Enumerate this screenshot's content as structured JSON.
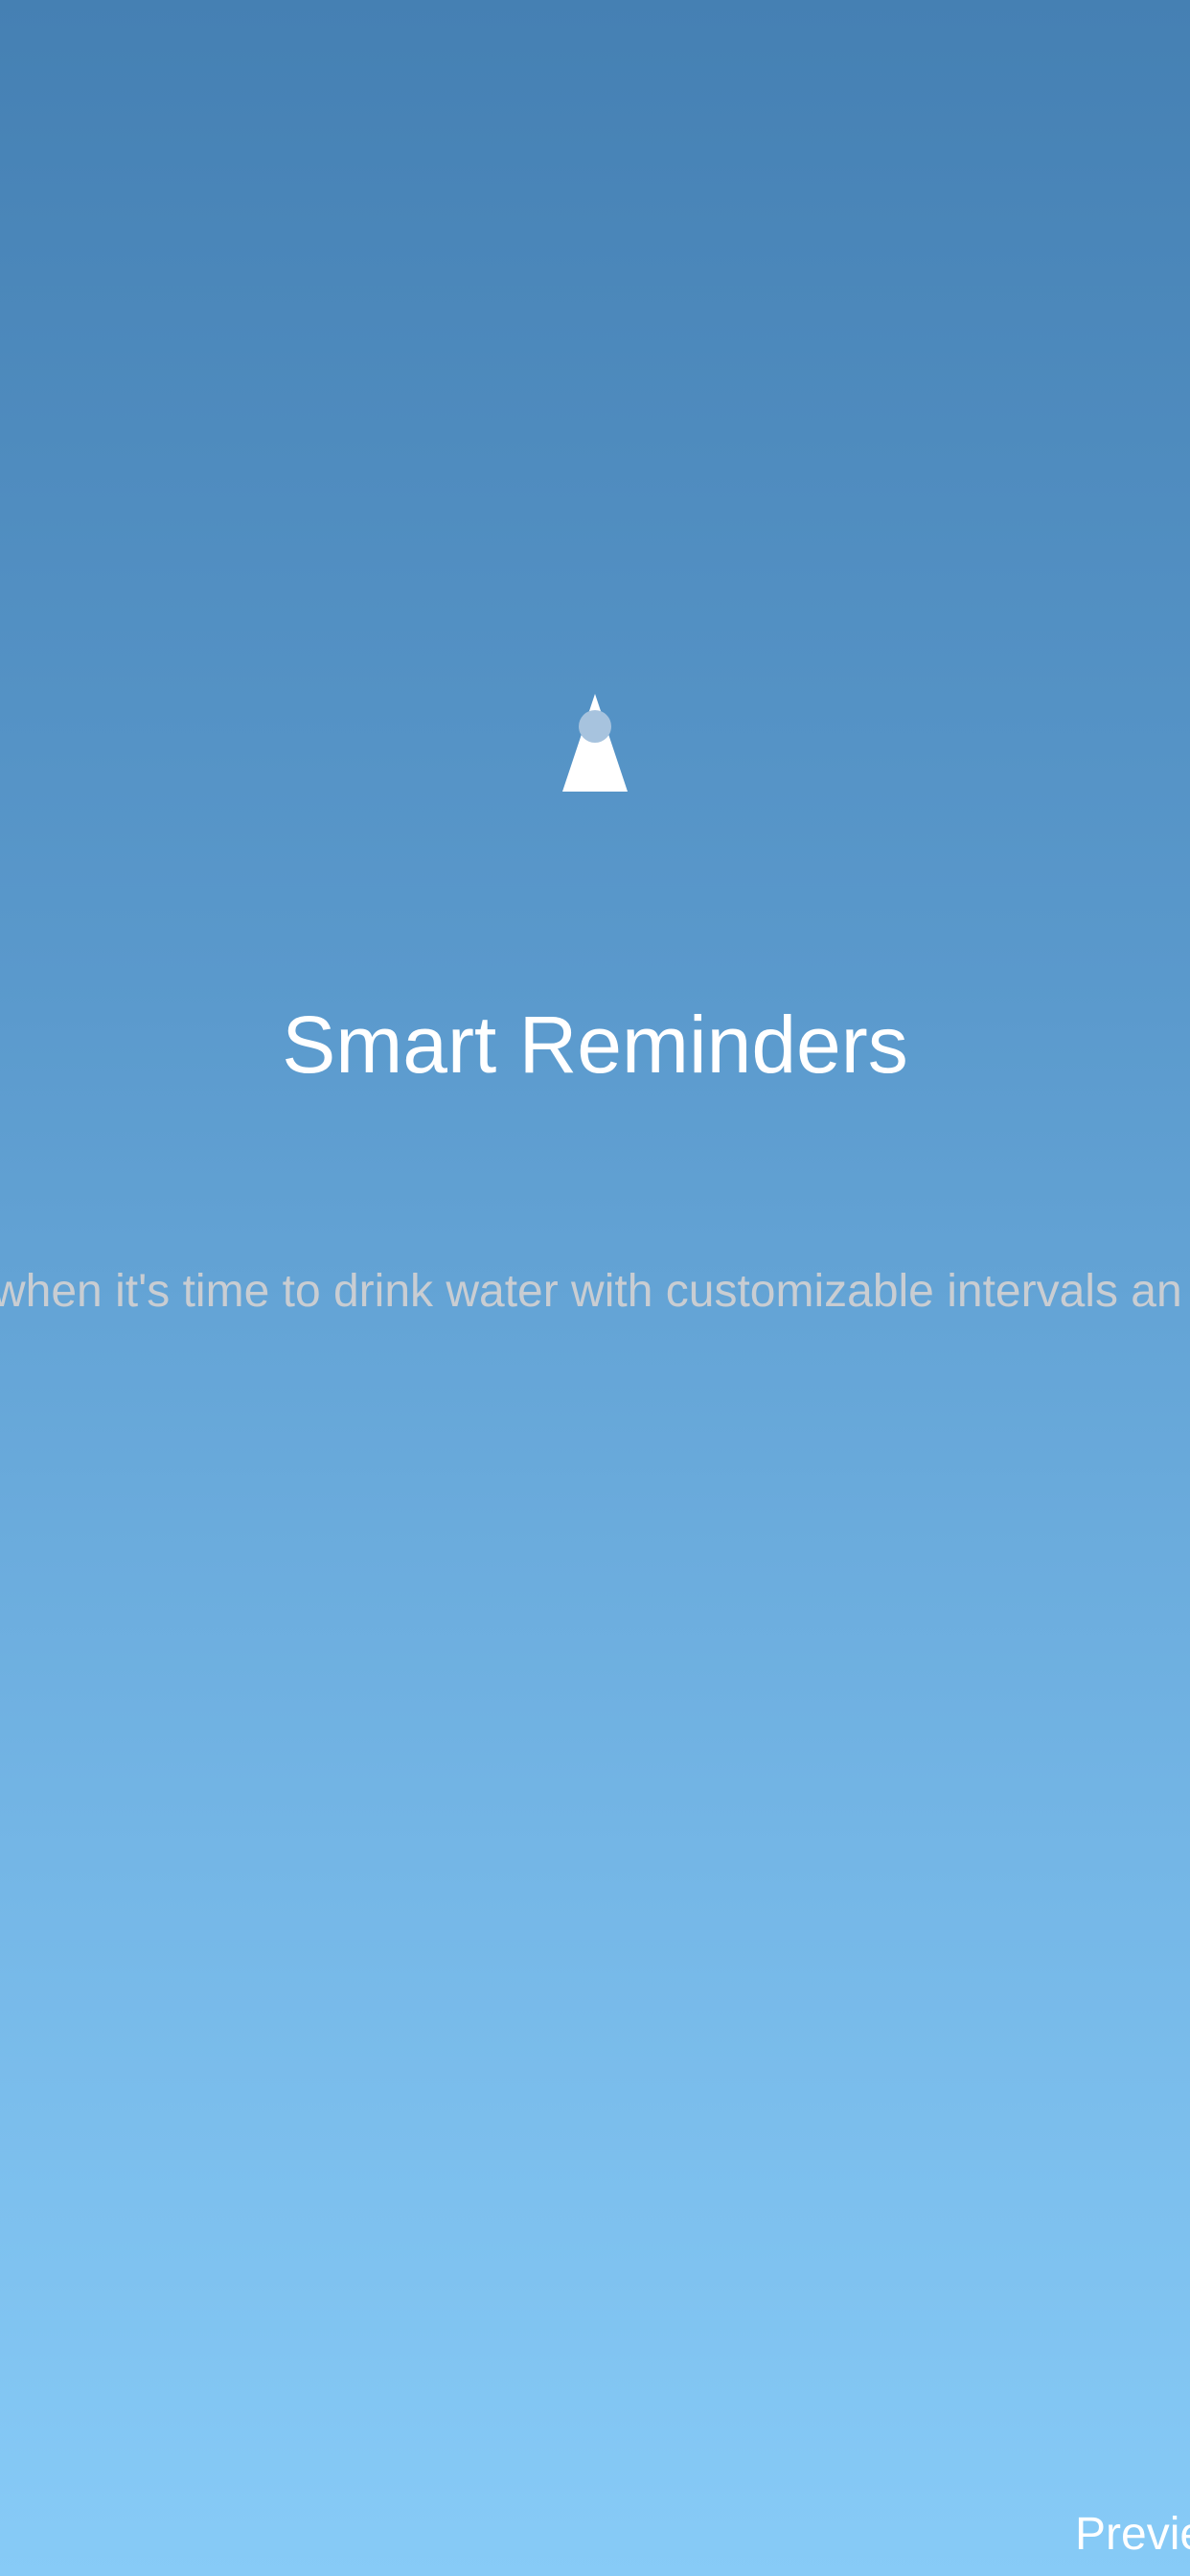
{
  "onboarding": {
    "icon": "bell-icon",
    "title": "Smart Reminders",
    "description": "when it's time to drink water with customizable intervals an",
    "preview_label": "Previe"
  },
  "colors": {
    "background_top": "#4580b3",
    "background_bottom": "#87cbf7",
    "icon_fill": "#ffffff",
    "icon_accent": "#a7c3de",
    "title_text": "#ffffff",
    "description_text": "#c9cdd2"
  }
}
